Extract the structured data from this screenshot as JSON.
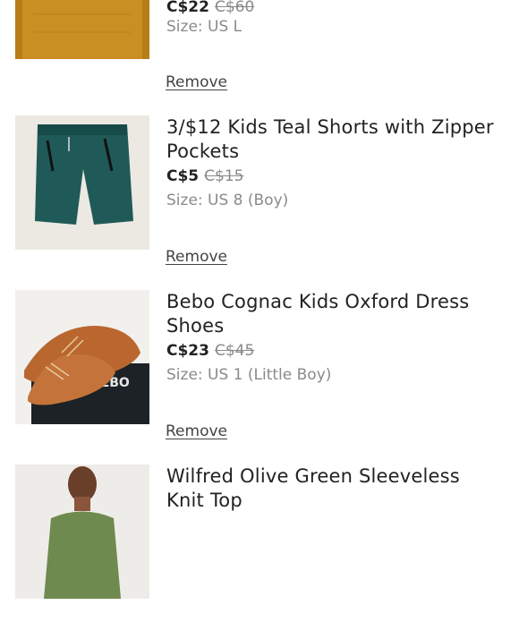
{
  "cart": {
    "remove_label": "Remove",
    "items": [
      {
        "title": "",
        "price": "C$22",
        "original_price": "C$60",
        "size": "Size: US L",
        "image_icon": "mustard-knit-sweater"
      },
      {
        "title": "3/$12 Kids Teal Shorts with Zipper Pockets",
        "price": "C$5",
        "original_price": "C$15",
        "size": "Size: US 8 (Boy)",
        "image_icon": "teal-shorts"
      },
      {
        "title": "Bebo Cognac Kids Oxford Dress Shoes",
        "price": "C$23",
        "original_price": "C$45",
        "size": "Size: US 1 (Little Boy)",
        "image_icon": "cognac-oxford-shoes",
        "image_text": "BEBO"
      },
      {
        "title": "Wilfred Olive Green Sleeveless Knit Top",
        "price": "",
        "original_price": "",
        "size": "",
        "image_icon": "olive-knit-top"
      }
    ]
  }
}
